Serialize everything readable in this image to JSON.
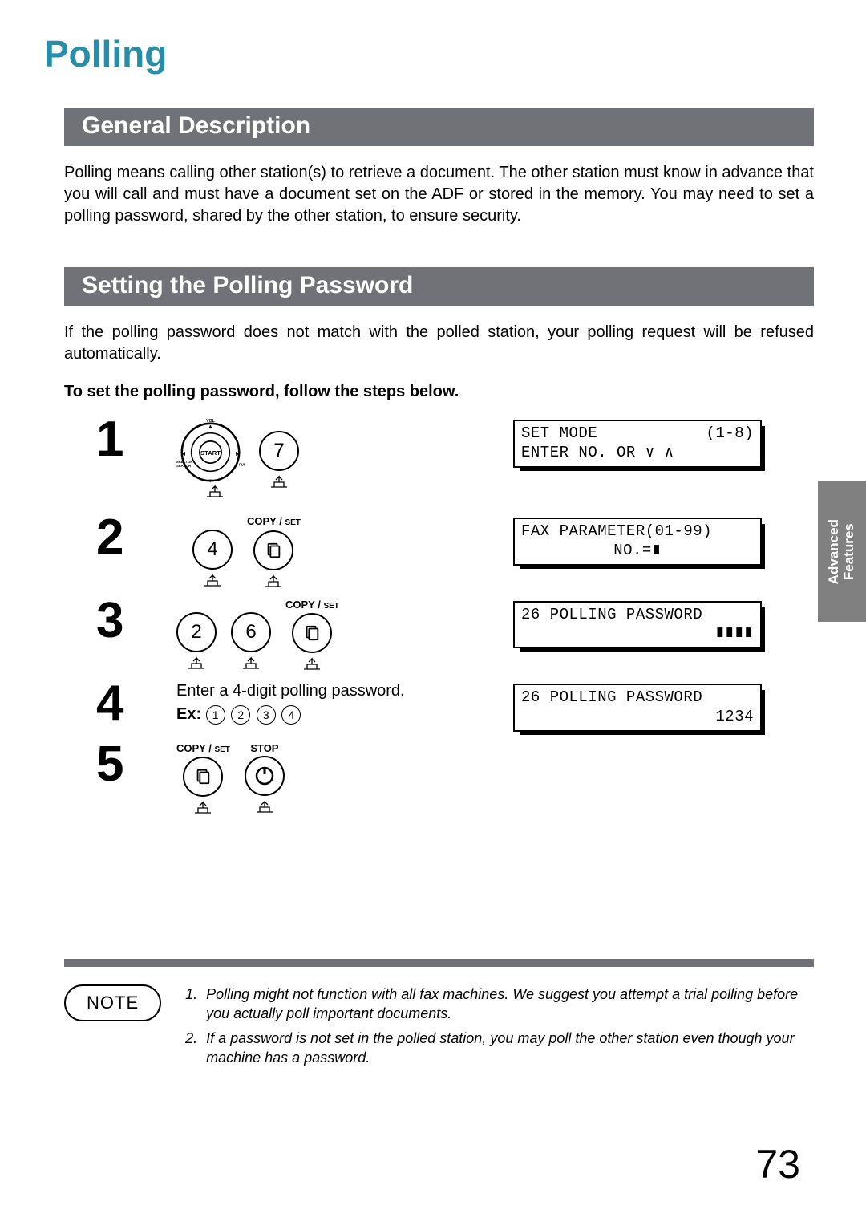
{
  "side_tab": {
    "line1": "Advanced",
    "line2": "Features"
  },
  "title": "Polling",
  "sections": {
    "general": {
      "heading": "General Description",
      "body": "Polling means calling other station(s) to retrieve a document.  The other station must know in advance that you will call and must have a document set on the ADF or stored in the memory.  You may need to set a polling password, shared by the other station, to ensure security."
    },
    "password": {
      "heading": "Setting the Polling Password",
      "intro": "If the polling password does not match with the polled station, your polling request will be refused automatically.",
      "instruction": "To set the polling password, follow the steps below."
    }
  },
  "labels": {
    "copy": "COPY / ",
    "set": "SET",
    "stop": "STOP",
    "function": "FUNCTION",
    "directory": "DIRECTORY",
    "search": "SEARCH",
    "start": "START",
    "vol": "VOL"
  },
  "steps": [
    {
      "num": "1",
      "keys": [
        "dial",
        "7"
      ],
      "lcd": {
        "row1_left": "SET MODE",
        "row1_right": "(1-8)",
        "row2": "ENTER NO. OR ∨  ∧"
      }
    },
    {
      "num": "2",
      "keys": [
        "4",
        "copyset"
      ],
      "lcd": {
        "row1_left": "FAX PARAMETER(01-99)",
        "row1_right": "",
        "row2_center": "NO.=∎"
      }
    },
    {
      "num": "3",
      "keys": [
        "2",
        "6",
        "copyset"
      ],
      "lcd": {
        "row1_left": "26 POLLING PASSWORD",
        "row1_right": "",
        "row2_right": "∎∎∎∎"
      }
    },
    {
      "num": "4",
      "text": "Enter a 4-digit polling password.",
      "ex_label": "Ex:",
      "ex_digits": [
        "1",
        "2",
        "3",
        "4"
      ],
      "lcd": {
        "row1_left": "26 POLLING PASSWORD",
        "row1_right": "",
        "row2_right": "1234"
      }
    },
    {
      "num": "5",
      "keys": [
        "copyset",
        "stop"
      ]
    }
  ],
  "note": {
    "label": "NOTE",
    "items": [
      "Polling might not function with all fax machines.  We suggest you attempt a trial polling before you actually poll important documents.",
      "If a password is not set in the polled station, you may poll the other station even though your machine has a password."
    ]
  },
  "page_number": "73"
}
